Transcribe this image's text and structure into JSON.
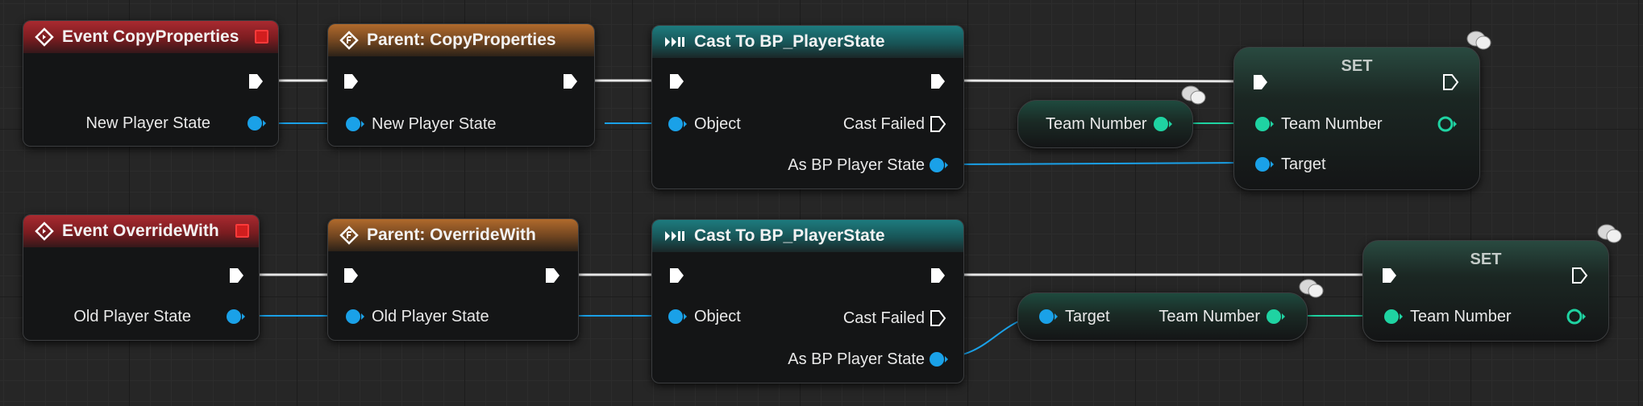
{
  "row1": {
    "event": {
      "title": "Event CopyProperties",
      "pin": "New Player State"
    },
    "parent": {
      "title": "Parent: CopyProperties",
      "pin": "New Player State"
    },
    "cast": {
      "title": "Cast To BP_PlayerState",
      "object": "Object",
      "failed": "Cast Failed",
      "as": "As BP Player State"
    },
    "getter": {
      "label": "Team Number"
    },
    "set": {
      "title": "SET",
      "pin_value": "Team Number",
      "pin_target": "Target"
    }
  },
  "row2": {
    "event": {
      "title": "Event OverrideWith",
      "pin": "Old Player State"
    },
    "parent": {
      "title": "Parent: OverrideWith",
      "pin": "Old Player State"
    },
    "cast": {
      "title": "Cast To BP_PlayerState",
      "object": "Object",
      "failed": "Cast Failed",
      "as": "As BP Player State"
    },
    "getter": {
      "target": "Target",
      "label": "Team Number"
    },
    "set": {
      "title": "SET",
      "pin_value": "Team Number"
    }
  },
  "colors": {
    "object_pin": "#1aa1e8",
    "int_pin": "#1fd3a2",
    "event_header": "#a92a30",
    "parent_header": "#b06a2c",
    "cast_header": "#1d7b7e"
  },
  "icons": [
    "event-icon",
    "stop-icon",
    "function-icon",
    "cast-icon",
    "exec-pin-icon",
    "object-pin-icon",
    "integer-pin-icon",
    "comment-bubble-icon"
  ]
}
